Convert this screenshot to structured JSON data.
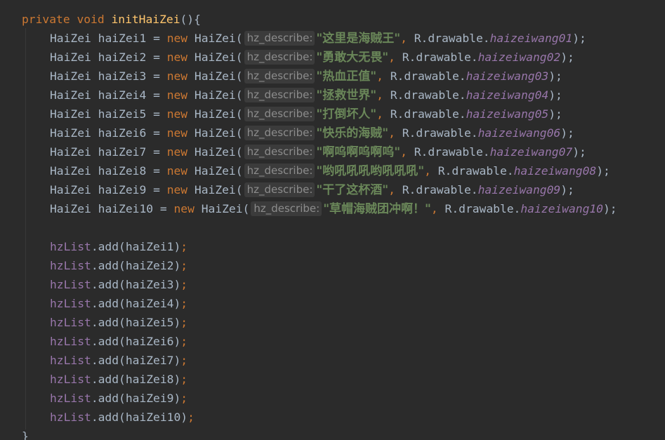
{
  "method": {
    "modifier": "private",
    "return_type": "void",
    "name": "initHaiZei",
    "signature_suffix": "(){",
    "closing_brace": "}"
  },
  "tokens": {
    "type_name": "HaiZei",
    "new_kw": "new",
    "assign": " = ",
    "open_paren": "(",
    "comma_sep": ", ",
    "drawable_prefix": "R.drawable.",
    "close_stmt": ");",
    "hint_label": "hz_describe:",
    "list_name": "hzList",
    "add_call": ".add(",
    "close_call": ")",
    "semicolon": ";"
  },
  "declarations": [
    {
      "var": "haiZei1",
      "desc": "\"这里是海贼王\"",
      "drawable": "haizeiwang01"
    },
    {
      "var": "haiZei2",
      "desc": "\"勇敢大无畏\"",
      "drawable": "haizeiwang02"
    },
    {
      "var": "haiZei3",
      "desc": "\"热血正值\"",
      "drawable": "haizeiwang03"
    },
    {
      "var": "haiZei4",
      "desc": "\"拯救世界\"",
      "drawable": "haizeiwang04"
    },
    {
      "var": "haiZei5",
      "desc": "\"打倒坏人\"",
      "drawable": "haizeiwang05"
    },
    {
      "var": "haiZei6",
      "desc": "\"快乐的海贼\"",
      "drawable": "haizeiwang06"
    },
    {
      "var": "haiZei7",
      "desc": "\"啊呜啊呜啊呜\"",
      "drawable": "haizeiwang07"
    },
    {
      "var": "haiZei8",
      "desc": "\"哟吼吼吼哟吼吼吼\"",
      "drawable": "haizeiwang08"
    },
    {
      "var": "haiZei9",
      "desc": "\"干了这杯酒\"",
      "drawable": "haizeiwang09"
    },
    {
      "var": "haiZei10",
      "desc": "\"草帽海贼团冲啊！\"",
      "drawable": "haizeiwang10"
    }
  ],
  "add_calls": [
    "haiZei1",
    "haiZei2",
    "haiZei3",
    "haiZei4",
    "haiZei5",
    "haiZei6",
    "haiZei7",
    "haiZei8",
    "haiZei9",
    "haiZei10"
  ],
  "colors": {
    "background": "#2b2b2b",
    "keyword": "#cc7832",
    "method_name": "#ffc66d",
    "string": "#6a8759",
    "field": "#9876aa",
    "default_text": "#a9b7c6",
    "hint_bg": "#3b3b3b",
    "hint_text": "#8c8c8c"
  }
}
